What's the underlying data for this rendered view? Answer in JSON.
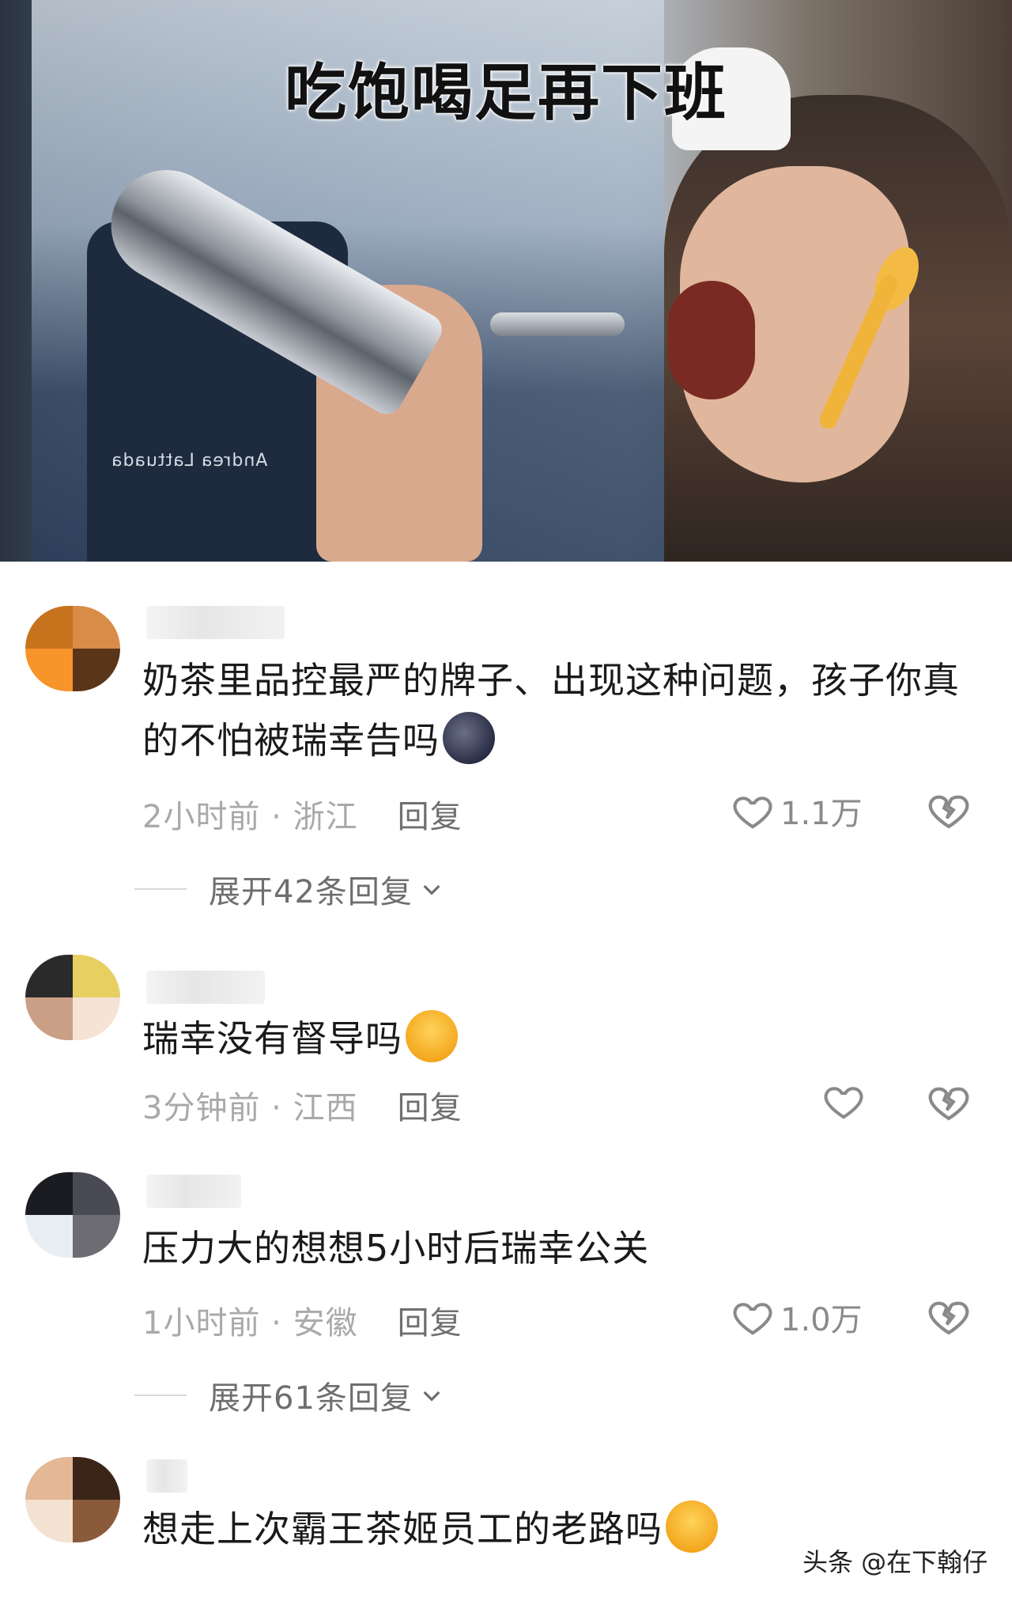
{
  "video": {
    "caption": "吃饱喝足再下班",
    "apron_text": "Andrea Lattuada"
  },
  "comments": [
    {
      "text": "奶茶里品控最严的牌子、出现这种问题，孩子你真的不怕被瑞幸告吗",
      "time": "2小时前",
      "location": "浙江",
      "reply_label": "回复",
      "likes": "1.1万",
      "expand": "展开42条回复",
      "emoji": "new-moon-face-emoji"
    },
    {
      "text": "瑞幸没有督导吗",
      "time": "3分钟前",
      "location": "江西",
      "reply_label": "回复",
      "likes": "",
      "emoji": "tears-of-joy-emoji"
    },
    {
      "text": "压力大的想想5小时后瑞幸公关",
      "time": "1小时前",
      "location": "安徽",
      "reply_label": "回复",
      "likes": "1.0万",
      "expand": "展开61条回复"
    },
    {
      "text": "想走上次霸王茶姬员工的老路吗",
      "emoji": "loudly-crying-laughing-emoji"
    }
  ],
  "meta_separator": " · ",
  "watermark": "头条 @在下翰仔"
}
